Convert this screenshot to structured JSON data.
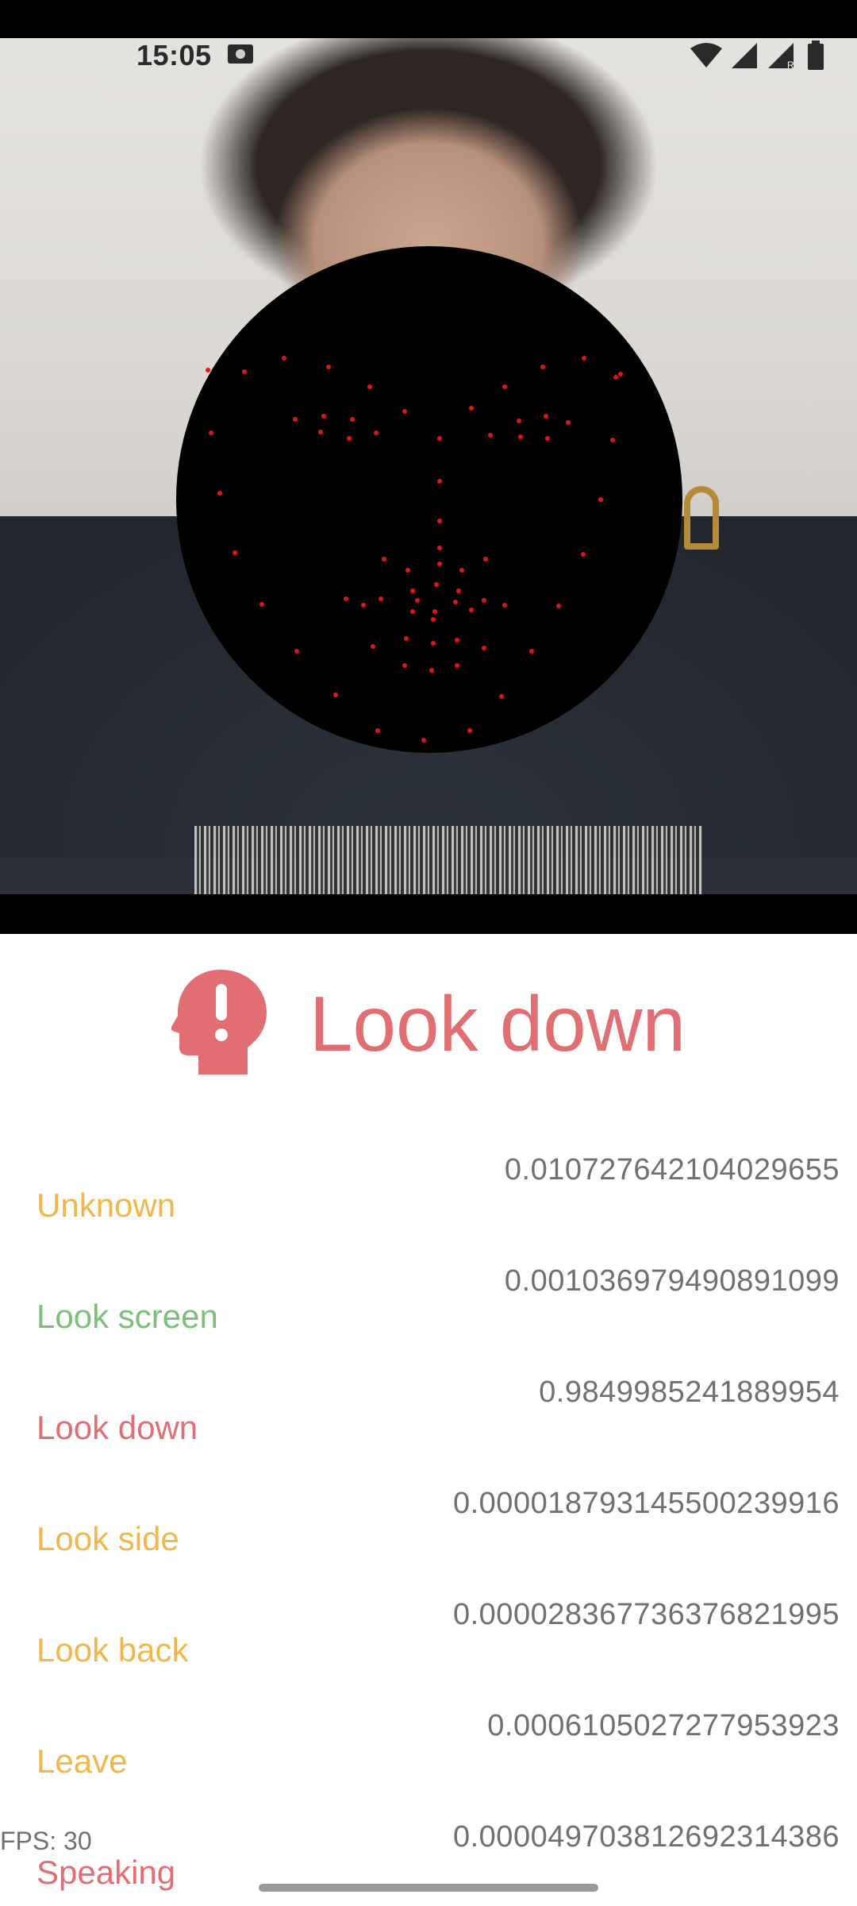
{
  "status_bar": {
    "time": "15:05",
    "icons": [
      "image-icon",
      "wifi-icon",
      "signal-icon",
      "roaming-signal-icon",
      "battery-icon"
    ]
  },
  "camera": {
    "description_icon": "camera-preview"
  },
  "result": {
    "icon": "head-alert-icon",
    "label": "Look down",
    "color": "#e06e72"
  },
  "probabilities": [
    {
      "label": "Unknown",
      "value": "0.010727642104029655",
      "color": "#f2b64c"
    },
    {
      "label": "Look screen",
      "value": "0.001036979490891099",
      "color": "#7cbf78"
    },
    {
      "label": "Look down",
      "value": "0.9849985241889954",
      "color": "#e06e72"
    },
    {
      "label": "Look side",
      "value": "0.000018793145500239916",
      "color": "#f2b64c"
    },
    {
      "label": "Look back",
      "value": "0.000028367736376821995",
      "color": "#f2b64c"
    },
    {
      "label": "Leave",
      "value": "0.0006105027277953923",
      "color": "#f2b64c"
    },
    {
      "label": "Speaking",
      "value": "0.000049703812692314386",
      "color": "#e06e72"
    }
  ],
  "fps": "FPS: 30"
}
